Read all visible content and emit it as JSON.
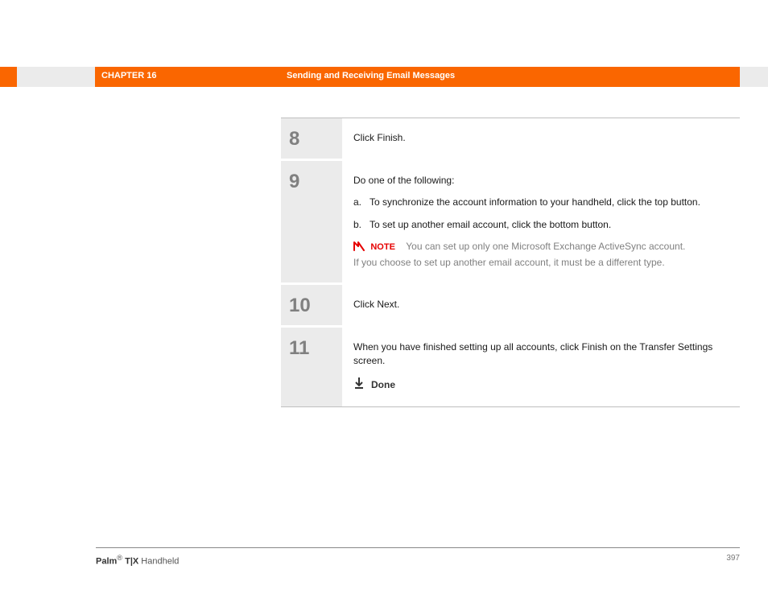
{
  "header": {
    "chapter": "CHAPTER 16",
    "section": "Sending and Receiving Email Messages"
  },
  "steps": [
    {
      "num": "8",
      "text": "Click Finish."
    },
    {
      "num": "9",
      "intro": "Do one of the following:",
      "items": [
        {
          "letter": "a.",
          "text": "To synchronize the account information to your handheld, click the top button."
        },
        {
          "letter": "b.",
          "text": "To set up another email account, click the bottom button."
        }
      ],
      "note_label": "NOTE",
      "note_text_a": "You can set up only one Microsoft Exchange ActiveSync account.",
      "note_text_b": "If you choose to set up another email account, it must be a different type."
    },
    {
      "num": "10",
      "text": "Click Next."
    },
    {
      "num": "11",
      "text": "When you have finished setting up all accounts, click Finish on the Transfer Settings screen.",
      "done": "Done"
    }
  ],
  "footer": {
    "brand_bold": "Palm",
    "reg": "®",
    "model": " T|X",
    "tail": " Handheld",
    "page": "397"
  }
}
